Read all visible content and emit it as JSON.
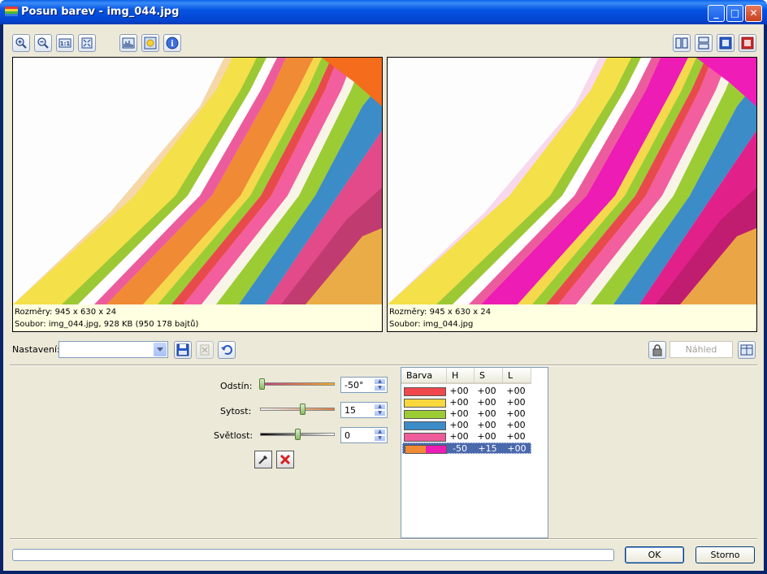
{
  "window": {
    "title": "Posun barev - img_044.jpg"
  },
  "toolbar": {
    "left_icons": [
      "zoom-in-icon",
      "zoom-out-icon",
      "actual-size-icon",
      "fit-window-icon",
      "histogram-icon",
      "auto-enhance-icon",
      "info-icon"
    ],
    "right_icons": [
      "side-by-side-vertical-icon",
      "side-by-side-horizontal-icon",
      "single-view-icon",
      "full-preview-icon"
    ]
  },
  "left_panel": {
    "line1": "Rozměry: 945 x 630 x 24",
    "line2": "Soubor: img_044.jpg, 928 KB (950 178 bajtů)"
  },
  "right_panel": {
    "line1": "Rozměry: 945 x 630 x 24",
    "line2": "Soubor: img_044.jpg"
  },
  "settings": {
    "label": "Nastavení:",
    "value": "",
    "preview_label": "Náhled"
  },
  "sliders": [
    {
      "label": "Odstín:",
      "value": "-50°",
      "position": 0.0
    },
    {
      "label": "Sytost:",
      "value": "15",
      "position": 0.57
    },
    {
      "label": "Světlost:",
      "value": "0",
      "position": 0.5
    }
  ],
  "color_list": {
    "columns": [
      "Barva",
      "H",
      "S",
      "L"
    ],
    "rows": [
      {
        "color": "#f0484c",
        "h": "+00",
        "s": "+00",
        "l": "+00"
      },
      {
        "color": "#f8d83c",
        "h": "+00",
        "s": "+00",
        "l": "+00"
      },
      {
        "color": "#9ccc34",
        "h": "+00",
        "s": "+00",
        "l": "+00"
      },
      {
        "color": "#3c8cc8",
        "h": "+00",
        "s": "+00",
        "l": "+00"
      },
      {
        "color": "#ee5c9c",
        "h": "+00",
        "s": "+00",
        "l": "+00"
      },
      {
        "color": "#f08a34",
        "color2": "#ec1cb4",
        "h": "-50",
        "s": "+15",
        "l": "+00",
        "selected": true
      }
    ]
  },
  "buttons": {
    "ok": "OK",
    "cancel": "Storno"
  },
  "progress": 0
}
